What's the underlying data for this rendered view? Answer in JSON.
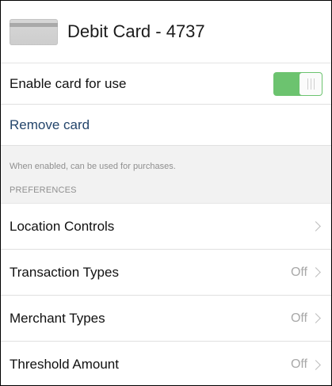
{
  "card": {
    "title": "Debit Card - 4737"
  },
  "enable": {
    "label": "Enable card for use",
    "on": true,
    "accent": "#6cc36f"
  },
  "remove": {
    "label": "Remove card"
  },
  "note": "When enabled, can be used for purchases.",
  "preferences": {
    "header": "PREFERENCES",
    "items": [
      {
        "label": "Location Controls",
        "value": ""
      },
      {
        "label": "Transaction Types",
        "value": "Off"
      },
      {
        "label": "Merchant Types",
        "value": "Off"
      },
      {
        "label": "Threshold Amount",
        "value": "Off"
      }
    ]
  }
}
